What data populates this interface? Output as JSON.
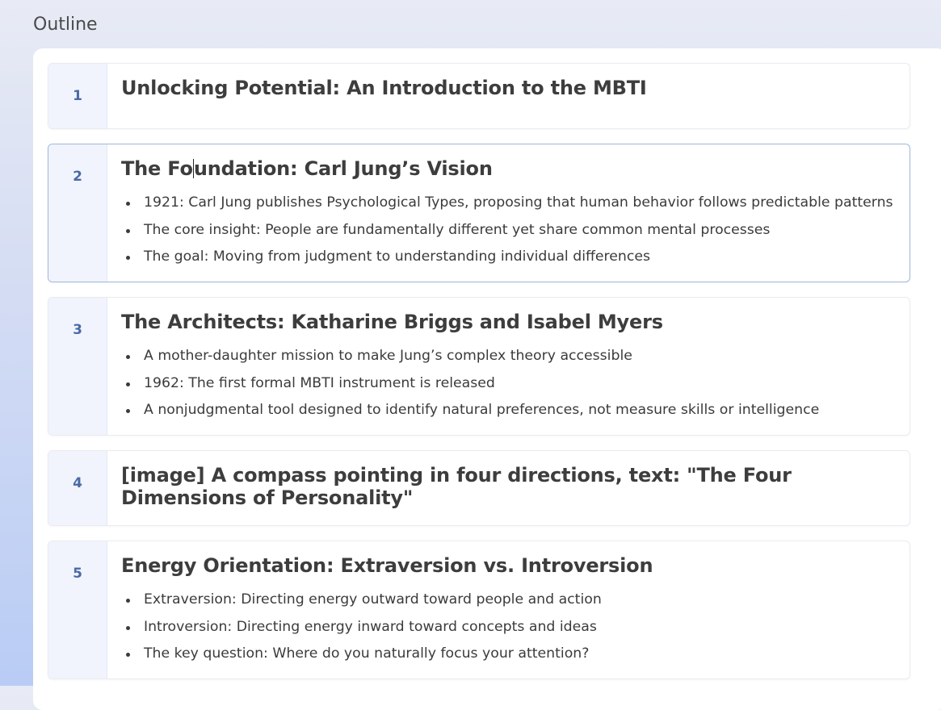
{
  "outline": {
    "heading": "Outline",
    "slides": [
      {
        "number": "1",
        "title": "Unlocking Potential: An Introduction to the MBTI",
        "bullets": []
      },
      {
        "number": "2",
        "title_before_caret": "The Fo",
        "title_after_caret": "undation: Carl Jung’s Vision",
        "bullets": [
          "1921: Carl Jung publishes Psychological Types, proposing that human behavior follows predictable patterns",
          "The core insight: People are fundamentally different yet share common mental processes",
          "The goal: Moving from judgment to understanding individual differences"
        ]
      },
      {
        "number": "3",
        "title": "The Architects: Katharine Briggs and Isabel Myers",
        "bullets": [
          "A mother-daughter mission to make Jung’s complex theory accessible",
          "1962: The first formal MBTI instrument is released",
          "A nonjudgmental tool designed to identify natural preferences, not measure skills or intelligence"
        ]
      },
      {
        "number": "4",
        "title": "[image] A compass pointing in four directions, text: \"The Four Dimensions of Personality\"",
        "bullets": []
      },
      {
        "number": "5",
        "title": "Energy Orientation: Extraversion vs. Introversion",
        "bullets": [
          "Extraversion: Directing energy outward toward people and action",
          "Introversion: Directing energy inward toward concepts and ideas",
          "The key question: Where do you naturally focus your attention?"
        ]
      }
    ]
  },
  "colors": {
    "number_text": "#4a6aa6",
    "number_column_bg": "#f1f4fd",
    "active_border": "#9fb8db",
    "title_text": "#3d3d3d"
  }
}
